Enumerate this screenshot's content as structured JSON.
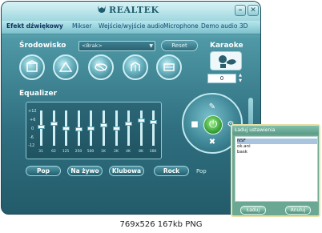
{
  "window": {
    "brand": "REALTEK",
    "controls": {
      "minimize": "–",
      "close": "✕"
    }
  },
  "tabs": [
    {
      "label": "Efekt dźwiękowy"
    },
    {
      "label": "Mikser"
    },
    {
      "label": "Wejście/wyjście audio"
    },
    {
      "label": "Microphone"
    },
    {
      "label": "Demo audio 3D"
    }
  ],
  "environment": {
    "label": "Środowisko",
    "selected": "<Brak>",
    "reset_label": "Reset",
    "icons": [
      "theater-icon",
      "hall-icon",
      "stadium-icon",
      "arena-icon",
      "room-icon"
    ]
  },
  "karaoke": {
    "label": "Karaoke",
    "value": "0"
  },
  "equalizer": {
    "label": "Equalizer",
    "db_labels": [
      "+12",
      "+6",
      "0",
      "-6",
      "-12"
    ],
    "bands": [
      {
        "freq": "31",
        "level": 0.45
      },
      {
        "freq": "62",
        "level": 0.35
      },
      {
        "freq": "125",
        "level": 0.5
      },
      {
        "freq": "250",
        "level": 0.55
      },
      {
        "freq": "500",
        "level": 0.5
      },
      {
        "freq": "1K",
        "level": 0.4
      },
      {
        "freq": "2K",
        "level": 0.5
      },
      {
        "freq": "4K",
        "level": 0.35
      },
      {
        "freq": "8K",
        "level": 0.25
      },
      {
        "freq": "16K",
        "level": 0.3
      }
    ],
    "presets": [
      "Pop",
      "Na żywo",
      "Klubowa",
      "Rock"
    ],
    "current_preset": "Pop"
  },
  "dialog": {
    "title": "Ładuj ustawienia",
    "items": [
      {
        "label": "NSF",
        "selected": true
      },
      {
        "label": "ok.ani",
        "selected": false
      },
      {
        "label": "bask",
        "selected": false
      }
    ],
    "ok_label": "Ładuj",
    "cancel_label": "Anuluj"
  },
  "caption": "769x526 167kb PNG",
  "colors": {
    "window_top": "#8ecfd6",
    "window_bottom": "#235b6a",
    "tab_text": "#0d4a74",
    "dialog_bg": "#6aa893",
    "wheel_center": "#3aa33b"
  }
}
